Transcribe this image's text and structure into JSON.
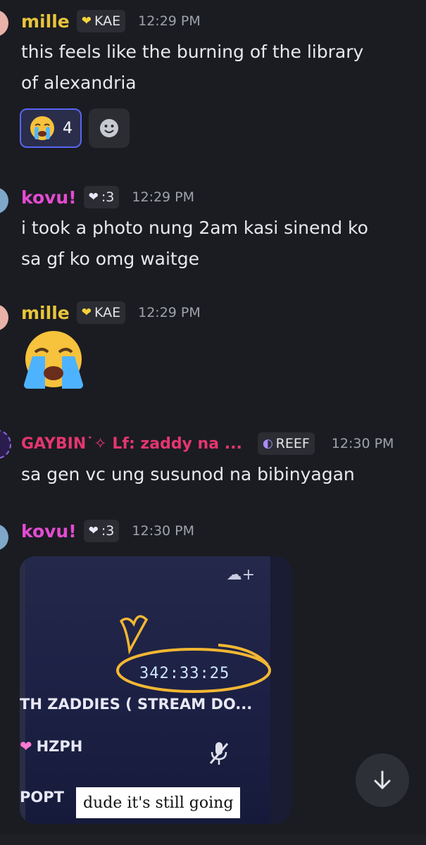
{
  "messages": [
    {
      "name": "mille",
      "name_color": "#e7c43c",
      "tag": "KAE",
      "tag_icon": "yellow-heart-icon",
      "time": "12:29 PM",
      "lines": [
        "this feels like the burning of the library",
        "of alexandria"
      ],
      "reaction": {
        "emoji": "crying-face-icon",
        "count": "4"
      }
    },
    {
      "name": "kovu!",
      "name_color": "#e44bd3",
      "tag": ":3",
      "tag_icon": "white-heart-icon",
      "time": "12:29 PM",
      "lines": [
        "i took a photo nung 2am kasi sinend ko",
        "sa gf ko omg waitge"
      ]
    },
    {
      "name": "mille",
      "name_color": "#e7c43c",
      "tag": "KAE",
      "tag_icon": "yellow-heart-icon",
      "time": "12:29 PM",
      "emoji": "loudly-crying-face-icon"
    },
    {
      "name": "GAYBIN˙✧ Lf: zaddy na ...",
      "name_color": "#e5356f",
      "tag": "REEF",
      "tag_icon": "moon-icon",
      "time": "12:30 PM",
      "lines": [
        "sa gen vc ung susunod na bibinyagan"
      ]
    },
    {
      "name": "kovu!",
      "name_color": "#e44bd3",
      "tag": ":3",
      "tag_icon": "white-heart-icon",
      "time": "12:30 PM",
      "image": {
        "timer": "342:33:25",
        "stream_title": "TH ZADDIES ( STREAM DO...",
        "user_tag": "HZPH",
        "user_label": "POPT",
        "caption": "dude it's still going"
      }
    }
  ],
  "scroll_button": {
    "icon": "arrow-down-icon"
  }
}
